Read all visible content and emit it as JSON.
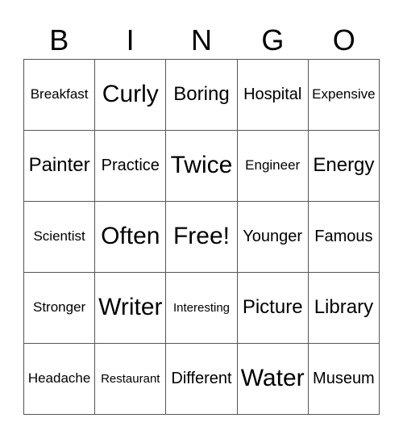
{
  "header": [
    "B",
    "I",
    "N",
    "G",
    "O"
  ],
  "cells": [
    [
      {
        "text": "Breakfast",
        "size": "s"
      },
      {
        "text": "Curly",
        "size": "xl"
      },
      {
        "text": "Boring",
        "size": "l"
      },
      {
        "text": "Hospital",
        "size": "m"
      },
      {
        "text": "Expensive",
        "size": "s"
      }
    ],
    [
      {
        "text": "Painter",
        "size": "l"
      },
      {
        "text": "Practice",
        "size": "m"
      },
      {
        "text": "Twice",
        "size": "xl"
      },
      {
        "text": "Engineer",
        "size": "s"
      },
      {
        "text": "Energy",
        "size": "l"
      }
    ],
    [
      {
        "text": "Scientist",
        "size": "s"
      },
      {
        "text": "Often",
        "size": "xl"
      },
      {
        "text": "Free!",
        "size": "xl"
      },
      {
        "text": "Younger",
        "size": "m"
      },
      {
        "text": "Famous",
        "size": "m"
      }
    ],
    [
      {
        "text": "Stronger",
        "size": "s"
      },
      {
        "text": "Writer",
        "size": "xl"
      },
      {
        "text": "Interesting",
        "size": "xs"
      },
      {
        "text": "Picture",
        "size": "l"
      },
      {
        "text": "Library",
        "size": "l"
      }
    ],
    [
      {
        "text": "Headache",
        "size": "s"
      },
      {
        "text": "Restaurant",
        "size": "xs"
      },
      {
        "text": "Different",
        "size": "m"
      },
      {
        "text": "Water",
        "size": "xl"
      },
      {
        "text": "Museum",
        "size": "m"
      }
    ]
  ]
}
